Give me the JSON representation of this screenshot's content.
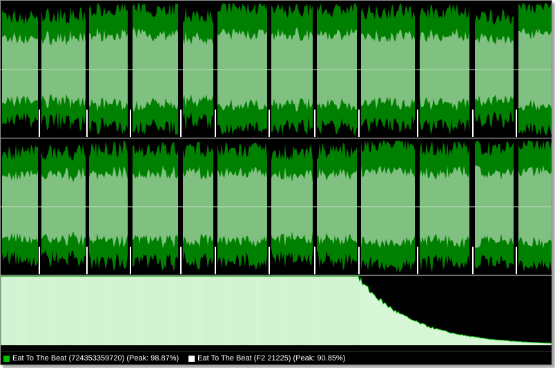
{
  "legend": {
    "items": [
      {
        "label": "Eat To The Beat (724353359720) (Peak: 98.87%)",
        "color": "#00c000"
      },
      {
        "label": "Eat To The Beat (F2 21225) (Peak: 90.85%)",
        "color": "#ffffff"
      }
    ]
  },
  "colors": {
    "background": "#000000",
    "wave_dark": "#008000",
    "wave_light": "#80c080",
    "track_divider": "#ffffff",
    "center_line": "#c0dcc0",
    "spectrum_fill": "#d6f6d6",
    "spectrum_edge": "#00c000"
  }
}
